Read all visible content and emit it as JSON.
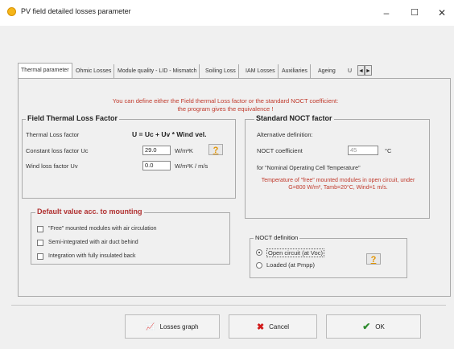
{
  "window": {
    "title": "PV field detailed losses parameter",
    "minimize_glyph": "–",
    "maximize_glyph": "☐",
    "close_glyph": "✕"
  },
  "tabs": {
    "items": [
      {
        "label": "Thermal parameter",
        "active": true
      },
      {
        "label": "Ohmic Losses"
      },
      {
        "label": "Module quality - LID - Mismatch"
      },
      {
        "label": "Soiling Loss"
      },
      {
        "label": "IAM Losses"
      },
      {
        "label": "Auxiliaries"
      },
      {
        "label": "Ageing"
      },
      {
        "label": "U"
      }
    ],
    "scroll_left": "◄",
    "scroll_right": "►"
  },
  "info": {
    "line1": "You can define either the Field thermal Loss factor or the standard NOCT coefficient:",
    "line2": "the program gives the equivalence !"
  },
  "field_thermal": {
    "title": "Field Thermal Loss Factor",
    "thermal_loss_label": "Thermal Loss factor",
    "formula": "U = Uc + Uv * Wind vel.",
    "constant_label": "Constant loss factor  Uc",
    "constant_value": "29.0",
    "constant_unit": "W/m²K",
    "wind_label": "Wind loss factor  Uv",
    "wind_value": "0.0",
    "wind_unit": "W/m²K / m/s",
    "help_glyph": "?"
  },
  "mounting": {
    "title": "Default value acc. to mounting",
    "options": [
      "\"Free\" mounted modules with air circulation",
      "Semi-integrated with air duct behind",
      "Integration with fully insulated back"
    ]
  },
  "noct": {
    "title": "Standard NOCT factor",
    "alt_label": "Alternative definition:",
    "coef_label": "NOCT coefficient",
    "coef_value": "45",
    "coef_unit": "°C",
    "for_label": "for \"Nominal Operating Cell Temperature\"",
    "note": "Temperature of \"free\" mounted modules in open circuit, under G=800 W/m², Tamb=20°C, Wind=1 m/s."
  },
  "noct_def": {
    "title": "NOCT definition",
    "options": [
      {
        "label": "Open circuit (at Voc)",
        "selected": true
      },
      {
        "label": "Loaded (at Pmpp)",
        "selected": false
      }
    ],
    "help_glyph": "?"
  },
  "buttons": {
    "graph": {
      "label": "Losses graph",
      "icon_glyph": "📈"
    },
    "cancel": {
      "label": "Cancel",
      "icon_glyph": "✖",
      "color": "#d11a1a"
    },
    "ok": {
      "label": "OK",
      "icon_glyph": "✔",
      "color": "#2e8b2e"
    }
  }
}
